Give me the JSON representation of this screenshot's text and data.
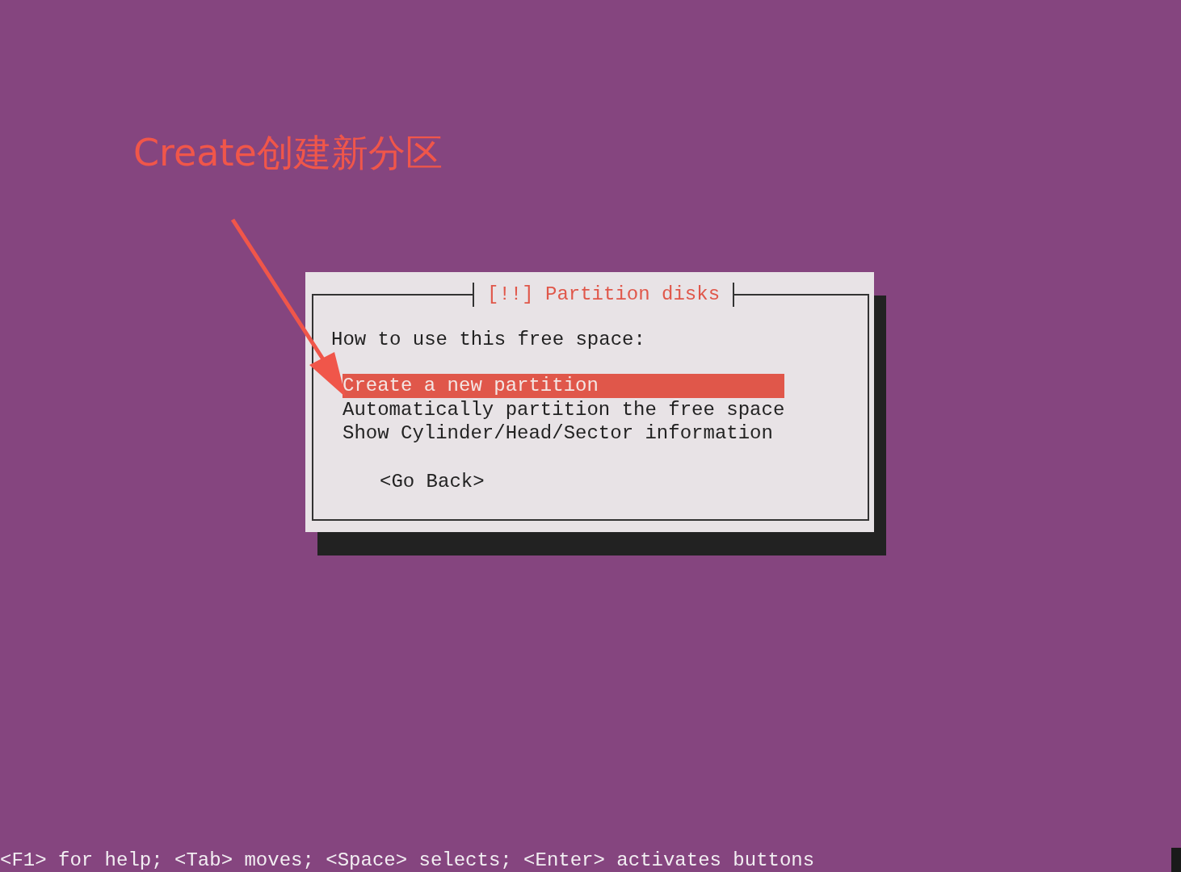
{
  "annotation": {
    "label": "Create创建新分区"
  },
  "dialog": {
    "title": "[!!] Partition disks",
    "prompt": "How to use this free space:",
    "options": [
      {
        "label": "Create a new partition",
        "selected": true
      },
      {
        "label": "Automatically partition the free space",
        "selected": false
      },
      {
        "label": "Show Cylinder/Head/Sector information",
        "selected": false
      }
    ],
    "buttons": [
      "<Go Back>"
    ]
  },
  "status_bar": "<F1> for help; <Tab> moves; <Space> selects; <Enter> activates buttons"
}
